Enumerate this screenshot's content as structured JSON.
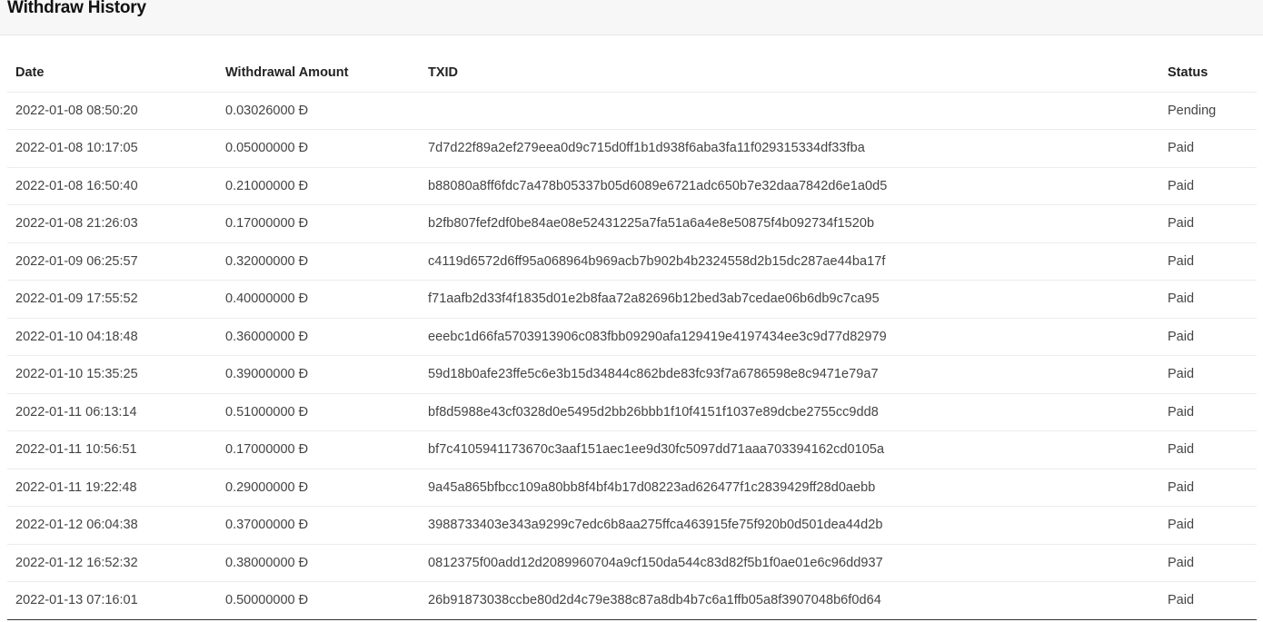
{
  "header": {
    "title": "Withdraw History"
  },
  "table": {
    "columns": [
      "Date",
      "Withdrawal Amount",
      "TXID",
      "Status"
    ],
    "rows": [
      {
        "date": "2022-01-08 08:50:20",
        "amount": "0.03026000 Đ",
        "txid": "",
        "status": "Pending"
      },
      {
        "date": "2022-01-08 10:17:05",
        "amount": "0.05000000 Đ",
        "txid": "7d7d22f89a2ef279eea0d9c715d0ff1b1d938f6aba3fa11f029315334df33fba",
        "status": "Paid"
      },
      {
        "date": "2022-01-08 16:50:40",
        "amount": "0.21000000 Đ",
        "txid": "b88080a8ff6fdc7a478b05337b05d6089e6721adc650b7e32daa7842d6e1a0d5",
        "status": "Paid"
      },
      {
        "date": "2022-01-08 21:26:03",
        "amount": "0.17000000 Đ",
        "txid": "b2fb807fef2df0be84ae08e52431225a7fa51a6a4e8e50875f4b092734f1520b",
        "status": "Paid"
      },
      {
        "date": "2022-01-09 06:25:57",
        "amount": "0.32000000 Đ",
        "txid": "c4119d6572d6ff95a068964b969acb7b902b4b2324558d2b15dc287ae44ba17f",
        "status": "Paid"
      },
      {
        "date": "2022-01-09 17:55:52",
        "amount": "0.40000000 Đ",
        "txid": "f71aafb2d33f4f1835d01e2b8faa72a82696b12bed3ab7cedae06b6db9c7ca95",
        "status": "Paid"
      },
      {
        "date": "2022-01-10 04:18:48",
        "amount": "0.36000000 Đ",
        "txid": "eeebc1d66fa5703913906c083fbb09290afa129419e4197434ee3c9d77d82979",
        "status": "Paid"
      },
      {
        "date": "2022-01-10 15:35:25",
        "amount": "0.39000000 Đ",
        "txid": "59d18b0afe23ffe5c6e3b15d34844c862bde83fc93f7a6786598e8c9471e79a7",
        "status": "Paid"
      },
      {
        "date": "2022-01-11 06:13:14",
        "amount": "0.51000000 Đ",
        "txid": "bf8d5988e43cf0328d0e5495d2bb26bbb1f10f4151f1037e89dcbe2755cc9dd8",
        "status": "Paid"
      },
      {
        "date": "2022-01-11 10:56:51",
        "amount": "0.17000000 Đ",
        "txid": "bf7c4105941173670c3aaf151aec1ee9d30fc5097dd71aaa703394162cd0105a",
        "status": "Paid"
      },
      {
        "date": "2022-01-11 19:22:48",
        "amount": "0.29000000 Đ",
        "txid": "9a45a865bfbcc109a80bb8f4bf4b17d08223ad626477f1c2839429ff28d0aebb",
        "status": "Paid"
      },
      {
        "date": "2022-01-12 06:04:38",
        "amount": "0.37000000 Đ",
        "txid": "3988733403e343a9299c7edc6b8aa275ffca463915fe75f920b0d501dea44d2b",
        "status": "Paid"
      },
      {
        "date": "2022-01-12 16:52:32",
        "amount": "0.38000000 Đ",
        "txid": "0812375f00add12d2089960704a9cf150da544c83d82f5b1f0ae01e6c96dd937",
        "status": "Paid"
      },
      {
        "date": "2022-01-13 07:16:01",
        "amount": "0.50000000 Đ",
        "txid": "26b91873038ccbe80d2d4c79e388c87a8db4b7c6a1ffb05a8f3907048b6f0d64",
        "status": "Paid"
      }
    ]
  }
}
